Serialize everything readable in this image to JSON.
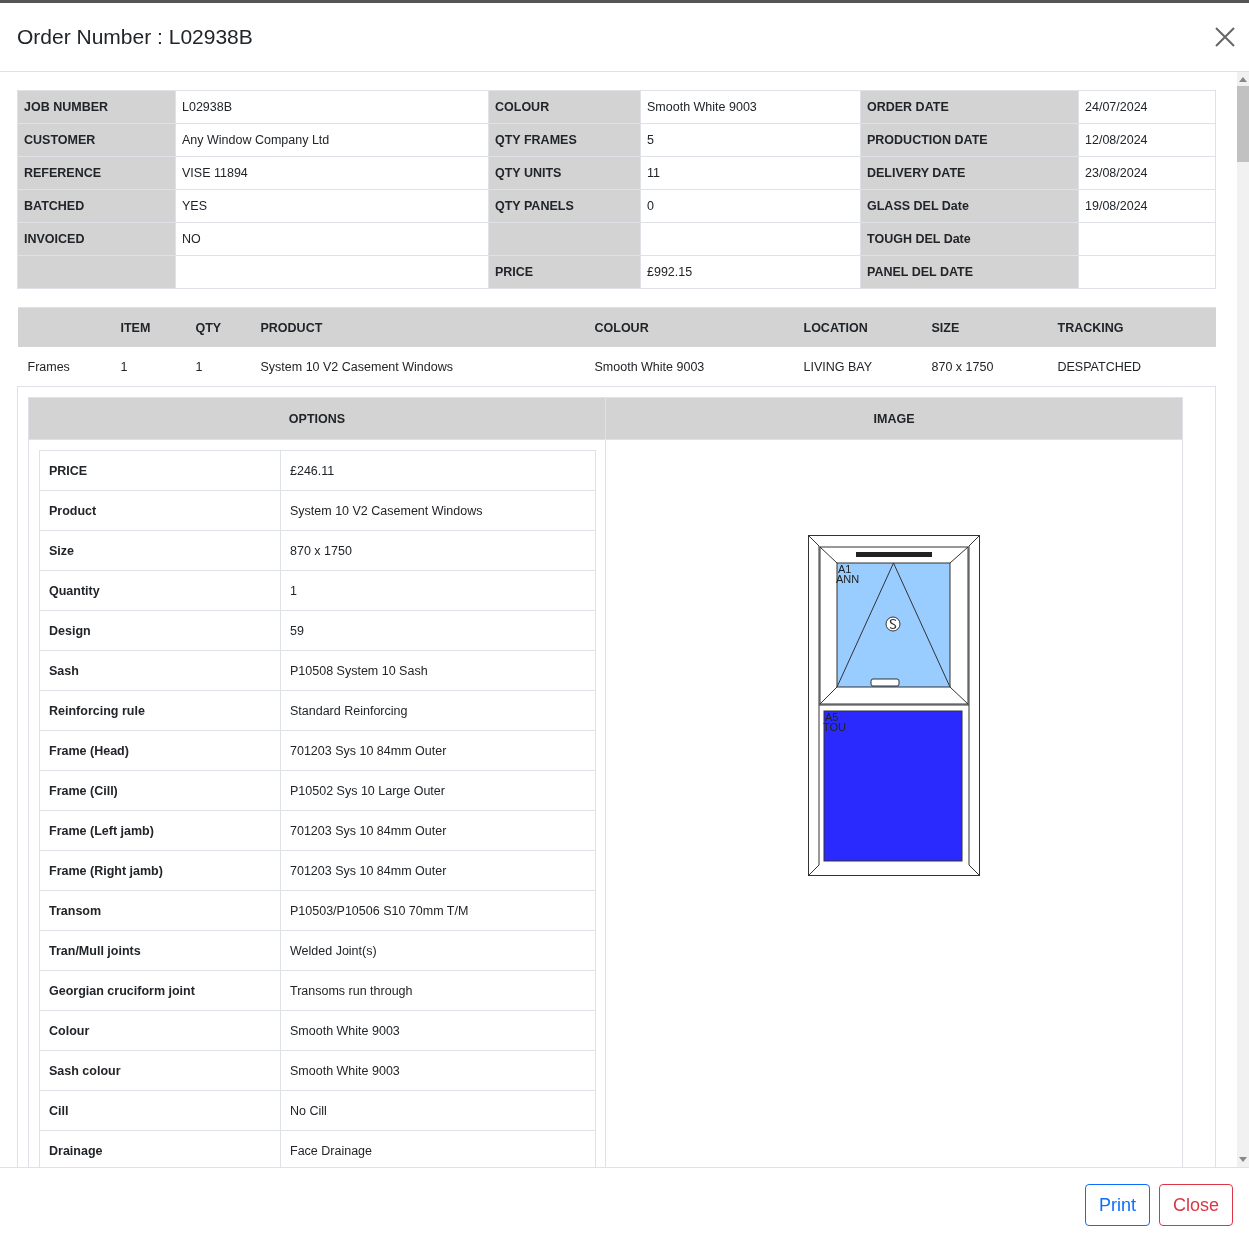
{
  "dialog": {
    "title": "Order Number : L02938B"
  },
  "summary": {
    "rows": [
      [
        {
          "label": "JOB NUMBER",
          "value": "L02938B"
        },
        {
          "label": "COLOUR",
          "value": "Smooth White 9003"
        },
        {
          "label": "ORDER DATE",
          "value": "24/07/2024"
        }
      ],
      [
        {
          "label": "CUSTOMER",
          "value": "Any Window Company Ltd"
        },
        {
          "label": "QTY FRAMES",
          "value": "5"
        },
        {
          "label": "PRODUCTION DATE",
          "value": "12/08/2024"
        }
      ],
      [
        {
          "label": "REFERENCE",
          "value": "VISE 11894"
        },
        {
          "label": "QTY UNITS",
          "value": "11"
        },
        {
          "label": "DELIVERY DATE",
          "value": "23/08/2024"
        }
      ],
      [
        {
          "label": "BATCHED",
          "value": "YES"
        },
        {
          "label": "QTY PANELS",
          "value": "0"
        },
        {
          "label": "GLASS DEL Date",
          "value": "19/08/2024"
        }
      ],
      [
        {
          "label": "INVOICED",
          "value": "NO"
        },
        {},
        {
          "label": "TOUGH DEL Date"
        }
      ],
      [
        {},
        {
          "label": "PRICE",
          "value": "£992.15"
        },
        {
          "label": "PANEL DEL DATE"
        }
      ]
    ]
  },
  "items": {
    "columns": [
      "",
      "ITEM",
      "QTY",
      "PRODUCT",
      "COLOUR",
      "LOCATION",
      "SIZE",
      "TRACKING"
    ],
    "rows": [
      {
        "cells": [
          "Frames",
          "1",
          "1",
          "System 10 V2 Casement Windows",
          "Smooth White 9003",
          "LIVING BAY",
          "870 x 1750",
          "DESPATCHED"
        ],
        "detail": {
          "options_heading": "OPTIONS",
          "image_heading": "IMAGE",
          "options": [
            {
              "label": "PRICE",
              "value": "£246.11"
            },
            {
              "label": "Product",
              "value": "System 10 V2 Casement Windows"
            },
            {
              "label": "Size",
              "value": "870 x 1750"
            },
            {
              "label": "Quantity",
              "value": "1"
            },
            {
              "label": "Design",
              "value": "59"
            },
            {
              "label": "Sash",
              "value": "P10508 System 10 Sash"
            },
            {
              "label": "Reinforcing rule",
              "value": "Standard Reinforcing"
            },
            {
              "label": "Frame (Head)",
              "value": "701203 Sys 10 84mm Outer"
            },
            {
              "label": "Frame (Cill)",
              "value": "P10502 Sys 10 Large Outer"
            },
            {
              "label": "Frame (Left jamb)",
              "value": "701203 Sys 10 84mm Outer"
            },
            {
              "label": "Frame (Right jamb)",
              "value": "701203 Sys 10 84mm Outer"
            },
            {
              "label": "Transom",
              "value": "P10503/P10506 S10 70mm T/M"
            },
            {
              "label": "Tran/Mull joints",
              "value": "Welded Joint(s)"
            },
            {
              "label": "Georgian cruciform joint",
              "value": "Transoms run through"
            },
            {
              "label": "Colour",
              "value": "Smooth White 9003"
            },
            {
              "label": "Sash colour",
              "value": "Smooth White 9003"
            },
            {
              "label": "Cill",
              "value": "No Cill"
            },
            {
              "label": "Drainage",
              "value": "Face Drainage"
            }
          ],
          "image": {
            "panes": [
              {
                "kind": "top-hung",
                "code": "A1",
                "glass": "ANN"
              },
              {
                "kind": "fixed",
                "code": "A5",
                "glass": "TOU"
              }
            ]
          }
        }
      }
    ]
  },
  "buttons": [
    {
      "label": "Print",
      "kind": "primary"
    },
    {
      "label": "Close",
      "kind": "danger"
    }
  ]
}
